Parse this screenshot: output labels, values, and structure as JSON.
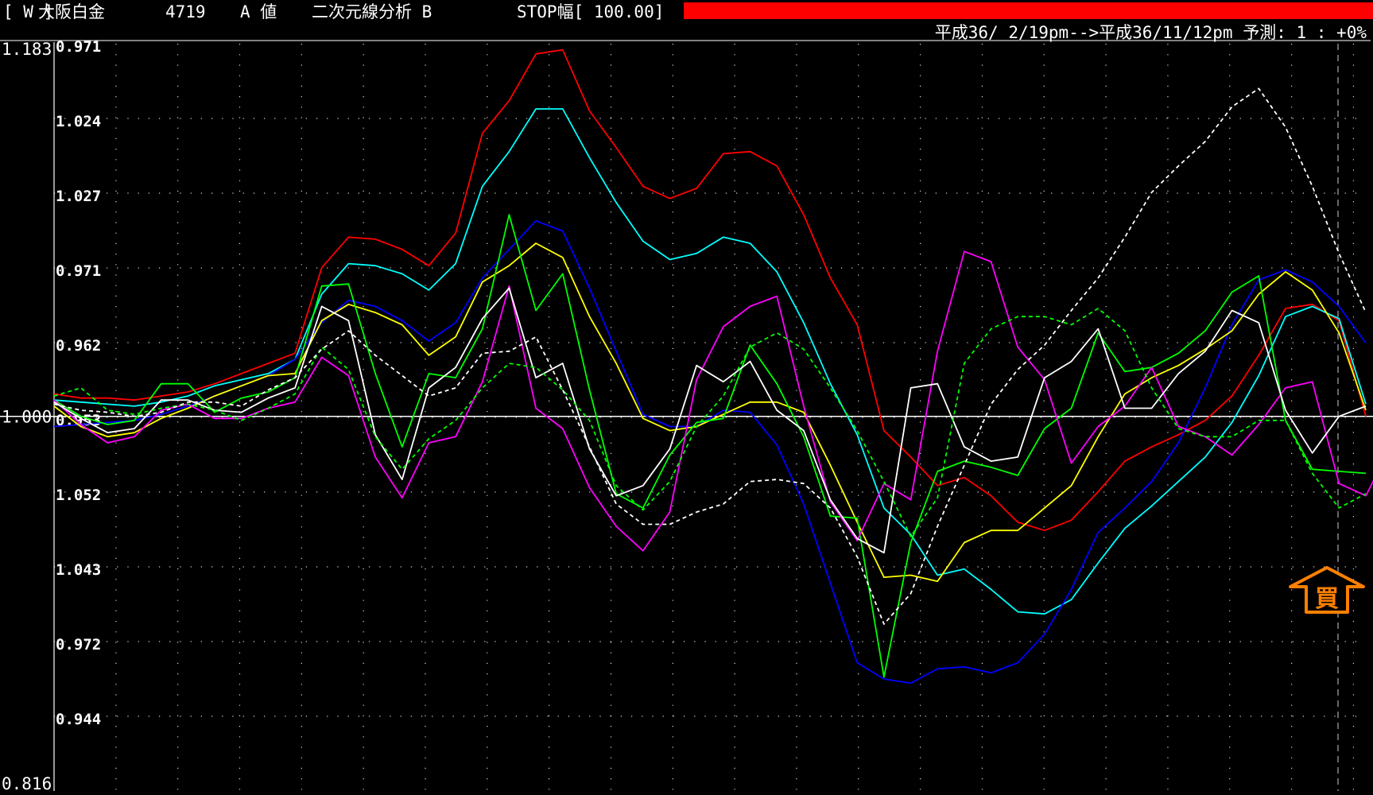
{
  "header": {
    "window_tag": "[ W ]",
    "name": "大阪白金",
    "code": "4719",
    "price_type": "A 値",
    "analysis": "二次元線分析 B",
    "stop": "STOP幅[ 100.00]",
    "bar_color": "#ff0000"
  },
  "date_range": "平成36/ 2/19pm-->平成36/11/12pm 予測: 1 : +0%",
  "chart_data": {
    "type": "line",
    "title": "",
    "xlabel": "",
    "ylabel": "",
    "ylim": [
      0.816,
      1.183
    ],
    "baseline": 1.0,
    "yaxis_outer": {
      "top": "1.183",
      "mid": "1.000",
      "bottom": "0.816"
    },
    "yaxis_inner": [
      "0.971",
      "1.024",
      "1.027",
      "0.971",
      "0.962",
      "0.953",
      "1.052",
      "1.043",
      "0.972",
      "0.944"
    ],
    "grid": true,
    "x_count": 50,
    "signal": {
      "label": "買",
      "kind": "buy-arrow",
      "color": "#ff8000"
    },
    "series": [
      {
        "color": "#ff0000",
        "dash": false,
        "values": [
          1.011,
          1.009,
          1.009,
          1.008,
          1.01,
          1.012,
          1.016,
          1.021,
          1.026,
          1.031,
          1.073,
          1.088,
          1.087,
          1.082,
          1.074,
          1.09,
          1.139,
          1.155,
          1.178,
          1.18,
          1.15,
          1.132,
          1.113,
          1.107,
          1.112,
          1.129,
          1.13,
          1.123,
          1.099,
          1.068,
          1.045,
          0.993,
          0.98,
          0.966,
          0.97,
          0.961,
          0.948,
          0.944,
          0.949,
          0.963,
          0.978,
          0.985,
          0.991,
          0.998,
          1.01,
          1.03,
          1.053,
          1.055,
          1.047,
          1.0
        ]
      },
      {
        "color": "#00ffff",
        "dash": false,
        "values": [
          1.008,
          1.007,
          1.006,
          1.005,
          1.007,
          1.01,
          1.015,
          1.018,
          1.021,
          1.028,
          1.06,
          1.075,
          1.074,
          1.07,
          1.062,
          1.075,
          1.113,
          1.13,
          1.151,
          1.151,
          1.127,
          1.105,
          1.086,
          1.077,
          1.08,
          1.088,
          1.085,
          1.071,
          1.046,
          1.016,
          0.991,
          0.955,
          0.942,
          0.922,
          0.925,
          0.915,
          0.904,
          0.903,
          0.91,
          0.928,
          0.945,
          0.956,
          0.968,
          0.98,
          0.997,
          1.02,
          1.049,
          1.054,
          1.048,
          1.006
        ]
      },
      {
        "color": "#0000ff",
        "dash": false,
        "values": [
          0.995,
          0.996,
          0.997,
          0.998,
          1.001,
          1.005,
          1.01,
          1.015,
          1.02,
          1.028,
          1.046,
          1.057,
          1.054,
          1.047,
          1.037,
          1.046,
          1.068,
          1.082,
          1.096,
          1.091,
          1.063,
          1.032,
          1.001,
          0.995,
          0.995,
          1.003,
          1.002,
          0.986,
          0.957,
          0.918,
          0.879,
          0.871,
          0.869,
          0.876,
          0.877,
          0.874,
          0.879,
          0.893,
          0.915,
          0.943,
          0.955,
          0.968,
          0.987,
          1.014,
          1.045,
          1.067,
          1.072,
          1.066,
          1.054,
          1.036
        ]
      },
      {
        "color": "#ffff00",
        "dash": false,
        "values": [
          1.005,
          0.995,
          0.99,
          0.992,
          0.999,
          1.004,
          1.01,
          1.015,
          1.02,
          1.021,
          1.047,
          1.055,
          1.051,
          1.045,
          1.03,
          1.039,
          1.066,
          1.074,
          1.085,
          1.078,
          1.049,
          1.026,
          0.999,
          0.993,
          0.995,
          1.001,
          1.007,
          1.007,
          1.002,
          0.976,
          0.948,
          0.921,
          0.922,
          0.919,
          0.938,
          0.944,
          0.944,
          0.955,
          0.966,
          0.99,
          1.011,
          1.019,
          1.025,
          1.033,
          1.042,
          1.06,
          1.071,
          1.062,
          1.041,
          1.003
        ]
      },
      {
        "color": "#00ff00",
        "dash": false,
        "values": [
          1.008,
          1.0,
          0.996,
          0.998,
          1.016,
          1.016,
          1.002,
          1.009,
          1.012,
          1.019,
          1.064,
          1.065,
          1.021,
          0.985,
          1.021,
          1.019,
          1.043,
          1.099,
          1.052,
          1.07,
          1.013,
          0.962,
          0.955,
          0.981,
          0.997,
          0.999,
          1.035,
          1.016,
          0.99,
          0.951,
          0.95,
          0.872,
          0.938,
          0.973,
          0.978,
          0.975,
          0.971,
          0.994,
          1.004,
          1.041,
          1.022,
          1.024,
          1.031,
          1.042,
          1.061,
          1.069,
          0.998,
          0.974,
          0.973,
          0.972
        ]
      },
      {
        "color": "#ff00ff",
        "dash": false,
        "values": [
          1.008,
          0.996,
          0.987,
          0.99,
          1.003,
          1.006,
          0.999,
          0.999,
          1.004,
          1.007,
          1.029,
          1.02,
          0.98,
          0.96,
          0.987,
          0.99,
          1.017,
          1.064,
          1.004,
          0.994,
          0.965,
          0.946,
          0.934,
          0.953,
          1.018,
          1.044,
          1.054,
          1.059,
          1.005,
          0.958,
          0.939,
          0.967,
          0.959,
          1.032,
          1.081,
          1.076,
          1.034,
          1.018,
          0.977,
          0.995,
          1.005,
          1.024,
          0.995,
          0.99,
          0.981,
          0.996,
          1.014,
          1.017,
          0.967,
          0.961,
          0.987
        ]
      },
      {
        "color": "#ffffff",
        "dash": false,
        "values": [
          1.007,
          0.999,
          0.992,
          0.994,
          1.008,
          1.008,
          1.003,
          1.002,
          1.009,
          1.014,
          1.054,
          1.047,
          0.991,
          0.969,
          1.014,
          1.024,
          1.048,
          1.063,
          1.019,
          1.026,
          0.984,
          0.961,
          0.966,
          0.984,
          1.025,
          1.017,
          1.027,
          1.003,
          0.993,
          0.959,
          0.94,
          0.933,
          1.014,
          1.016,
          0.985,
          0.978,
          0.98,
          1.019,
          1.027,
          1.043,
          1.004,
          1.004,
          1.021,
          1.032,
          1.052,
          1.046,
          1.003,
          0.982,
          1.0,
          1.005
        ]
      },
      {
        "color": "#00ff00",
        "dash": true,
        "values": [
          1.01,
          1.014,
          1.003,
          1.001,
          1.004,
          1.006,
          1.003,
          0.998,
          1.004,
          1.011,
          1.034,
          1.023,
          0.99,
          0.974,
          0.989,
          0.998,
          1.014,
          1.026,
          1.024,
          1.013,
          0.998,
          0.966,
          0.954,
          0.968,
          0.995,
          1.01,
          1.034,
          1.041,
          1.033,
          1.014,
          0.993,
          0.968,
          0.941,
          0.96,
          1.026,
          1.043,
          1.049,
          1.049,
          1.045,
          1.053,
          1.042,
          1.014,
          0.994,
          0.99,
          0.99,
          0.998,
          0.998,
          0.972,
          0.955,
          0.962
        ]
      },
      {
        "color": "#ffffff",
        "dash": true,
        "values": [
          1.006,
          1.003,
          1.002,
          1.0,
          1.002,
          1.007,
          1.007,
          1.005,
          1.013,
          1.019,
          1.033,
          1.042,
          1.03,
          1.02,
          1.01,
          1.014,
          1.031,
          1.032,
          1.039,
          1.013,
          0.985,
          0.957,
          0.947,
          0.947,
          0.953,
          0.957,
          0.968,
          0.969,
          0.967,
          0.955,
          0.931,
          0.898,
          0.913,
          0.946,
          0.976,
          1.006,
          1.023,
          1.035,
          1.052,
          1.068,
          1.088,
          1.11,
          1.123,
          1.135,
          1.152,
          1.161,
          1.142,
          1.113,
          1.08,
          1.051
        ]
      }
    ]
  }
}
